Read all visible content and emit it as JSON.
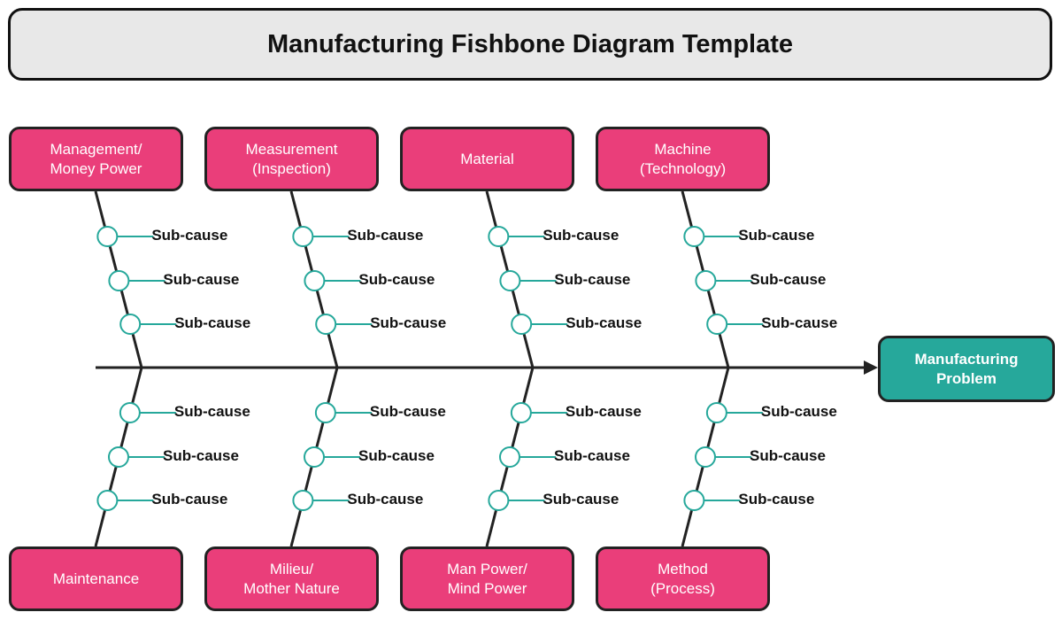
{
  "title": "Manufacturing Fishbone Diagram Template",
  "problem": {
    "label": "Manufacturing\nProblem",
    "color": "#26a89b"
  },
  "colors": {
    "category": "#ea3e7a",
    "node": "#26a89b",
    "spine": "#222222",
    "title_bg": "#e8e8e8"
  },
  "top_categories": [
    {
      "label": "Management/\nMoney Power",
      "sub_causes": [
        "Sub-cause",
        "Sub-cause",
        "Sub-cause"
      ]
    },
    {
      "label": "Measurement\n(Inspection)",
      "sub_causes": [
        "Sub-cause",
        "Sub-cause",
        "Sub-cause"
      ]
    },
    {
      "label": "Material",
      "sub_causes": [
        "Sub-cause",
        "Sub-cause",
        "Sub-cause"
      ]
    },
    {
      "label": "Machine\n(Technology)",
      "sub_causes": [
        "Sub-cause",
        "Sub-cause",
        "Sub-cause"
      ]
    }
  ],
  "bottom_categories": [
    {
      "label": "Maintenance",
      "sub_causes": [
        "Sub-cause",
        "Sub-cause",
        "Sub-cause"
      ]
    },
    {
      "label": "Milieu/\nMother Nature",
      "sub_causes": [
        "Sub-cause",
        "Sub-cause",
        "Sub-cause"
      ]
    },
    {
      "label": "Man Power/\nMind Power",
      "sub_causes": [
        "Sub-cause",
        "Sub-cause",
        "Sub-cause"
      ]
    },
    {
      "label": "Method\n(Process)",
      "sub_causes": [
        "Sub-cause",
        "Sub-cause",
        "Sub-cause"
      ]
    }
  ]
}
